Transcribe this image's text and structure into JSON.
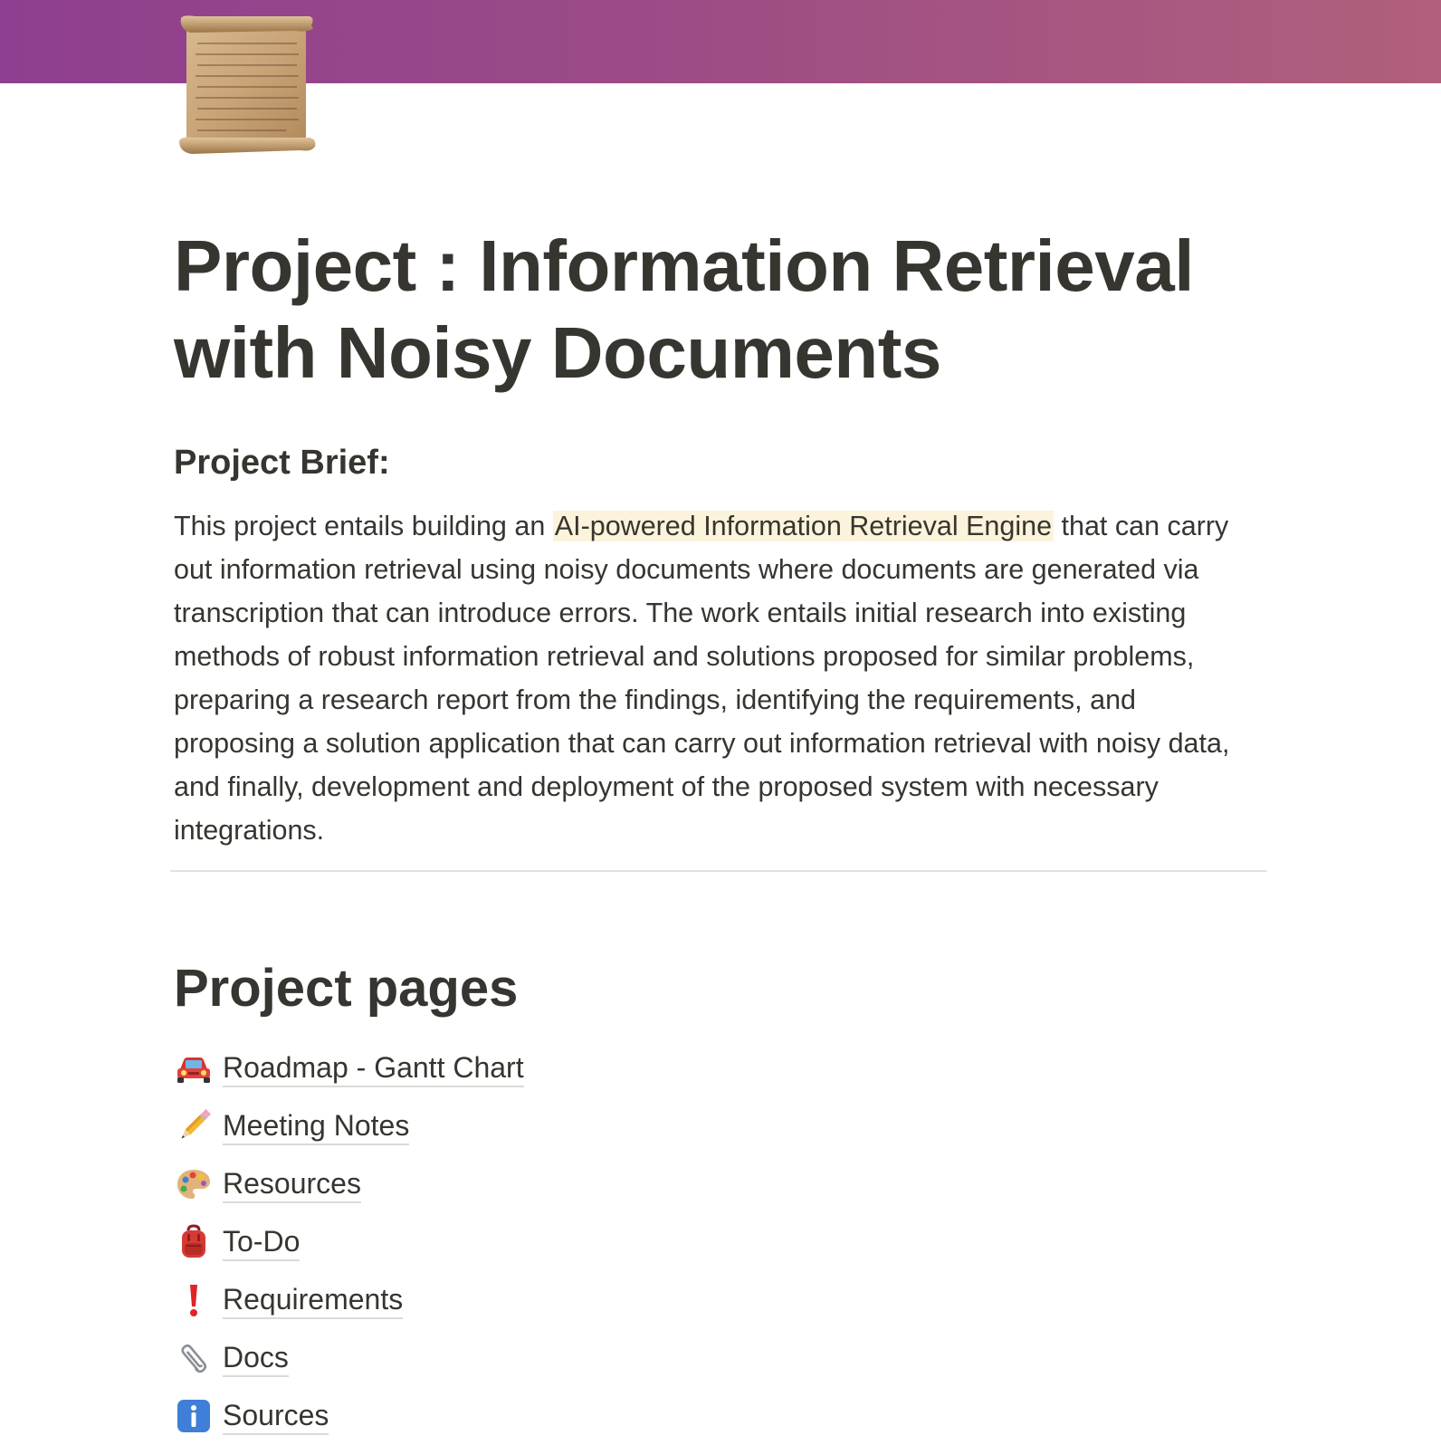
{
  "cover": {
    "gradient_start": "#8e3f8f",
    "gradient_end": "#b0607c"
  },
  "page": {
    "icon": "scroll-icon",
    "title": "Project : Information Retrieval with Noisy Documents"
  },
  "brief": {
    "heading": "Project Brief:",
    "text_before": "This project entails building an ",
    "highlight": "AI-powered Information Retrieval Engine",
    "text_after": " that can carry out information retrieval using noisy documents where documents are generated via transcription that can introduce errors. The work entails initial research into existing methods of robust information retrieval and solutions proposed for similar problems, preparing a research report from the findings, identifying the requirements, and proposing a solution application that can carry out information retrieval with noisy data, and finally, development and deployment of the proposed system with necessary integrations.",
    "highlight_color": "#fbf3db"
  },
  "project_pages": {
    "heading": "Project pages",
    "items": [
      {
        "icon": "car-icon",
        "label": "Roadmap - Gantt Chart"
      },
      {
        "icon": "pencil-icon",
        "label": "Meeting Notes"
      },
      {
        "icon": "palette-icon",
        "label": "Resources"
      },
      {
        "icon": "backpack-icon",
        "label": "To-Do"
      },
      {
        "icon": "exclamation-icon",
        "label": "Requirements"
      },
      {
        "icon": "paperclip-icon",
        "label": "Docs"
      },
      {
        "icon": "info-icon",
        "label": "Sources"
      }
    ]
  }
}
